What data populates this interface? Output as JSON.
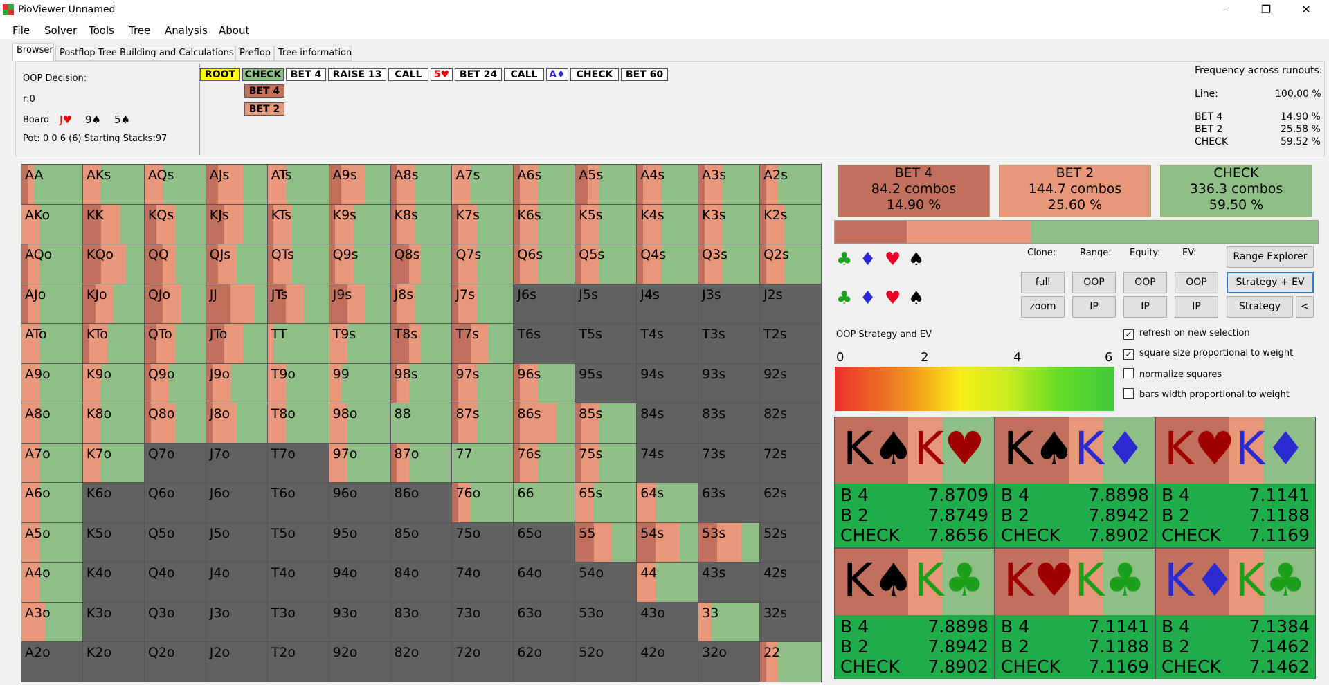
{
  "window": {
    "title": "PioViewer Unnamed",
    "controls": [
      "–",
      "❐",
      "✕"
    ]
  },
  "menu": [
    "File",
    "Solver",
    "Tools",
    "Tree",
    "Analysis",
    "About"
  ],
  "tabs": [
    "Browser",
    "Postflop Tree Building and Calculations",
    "Preflop",
    "Tree information"
  ],
  "info": {
    "decision": "OOP Decision:",
    "r": "r:0",
    "board_label": "Board",
    "board": [
      {
        "rank": "J",
        "suit": "♥",
        "color": "#e00"
      },
      {
        "rank": "9",
        "suit": "♠",
        "color": "#000"
      },
      {
        "rank": "5",
        "suit": "♠",
        "color": "#000"
      }
    ],
    "pot": "Pot: 0 0 6 (6) Starting Stacks:97"
  },
  "tree_nodes": [
    {
      "label": "ROOT",
      "bg": "#ffff00"
    },
    {
      "label": "CHECK",
      "bg": "#8fbf87"
    },
    {
      "label": "BET 4",
      "bg": "#ffffff"
    },
    {
      "label": "RAISE 13",
      "bg": "#ffffff"
    },
    {
      "label": "CALL",
      "bg": "#ffffff"
    },
    {
      "label": "5♥",
      "bg": "#ffffff",
      "color": "#e00"
    },
    {
      "label": "BET 24",
      "bg": "#ffffff"
    },
    {
      "label": "CALL",
      "bg": "#ffffff"
    },
    {
      "label": "A♦",
      "bg": "#ffffff",
      "color": "#2a2ad0"
    },
    {
      "label": "CHECK",
      "bg": "#ffffff"
    },
    {
      "label": "BET 60",
      "bg": "#ffffff"
    }
  ],
  "tree_alts": [
    {
      "label": "BET 4",
      "bg": "#c4705c"
    },
    {
      "label": "BET 2",
      "bg": "#e8977b"
    }
  ],
  "frequency": {
    "title": "Frequency across runouts:",
    "rows": [
      {
        "label": "Line:",
        "value": "100.00 %"
      },
      {
        "label": "BET 4",
        "value": "14.90 %"
      },
      {
        "label": "BET 2",
        "value": "25.58 %"
      },
      {
        "label": "CHECK",
        "value": "59.52 %"
      }
    ]
  },
  "colors": {
    "bet4": "#c0705d",
    "bet2": "#e8977b",
    "check": "#8fbf87",
    "empty": "#616161"
  },
  "grid": [
    [
      "AA",
      "AKs",
      "AQs",
      "AJs",
      "ATs",
      "A9s",
      "A8s",
      "A7s",
      "A6s",
      "A5s",
      "A4s",
      "A3s",
      "A2s"
    ],
    [
      "AKo",
      "KK",
      "KQs",
      "KJs",
      "KTs",
      "K9s",
      "K8s",
      "K7s",
      "K6s",
      "K5s",
      "K4s",
      "K3s",
      "K2s"
    ],
    [
      "AQo",
      "KQo",
      "QQ",
      "QJs",
      "QTs",
      "Q9s",
      "Q8s",
      "Q7s",
      "Q6s",
      "Q5s",
      "Q4s",
      "Q3s",
      "Q2s"
    ],
    [
      "AJo",
      "KJo",
      "QJo",
      "JJ",
      "JTs",
      "J9s",
      "J8s",
      "J7s",
      "J6s",
      "J5s",
      "J4s",
      "J3s",
      "J2s"
    ],
    [
      "ATo",
      "KTo",
      "QTo",
      "JTo",
      "TT",
      "T9s",
      "T8s",
      "T7s",
      "T6s",
      "T5s",
      "T4s",
      "T3s",
      "T2s"
    ],
    [
      "A9o",
      "K9o",
      "Q9o",
      "J9o",
      "T9o",
      "99",
      "98s",
      "97s",
      "96s",
      "95s",
      "94s",
      "93s",
      "92s"
    ],
    [
      "A8o",
      "K8o",
      "Q8o",
      "J8o",
      "T8o",
      "98o",
      "88",
      "87s",
      "86s",
      "85s",
      "84s",
      "83s",
      "82s"
    ],
    [
      "A7o",
      "K7o",
      "Q7o",
      "J7o",
      "T7o",
      "97o",
      "87o",
      "77",
      "76s",
      "75s",
      "74s",
      "73s",
      "72s"
    ],
    [
      "A6o",
      "K6o",
      "Q6o",
      "J6o",
      "T6o",
      "96o",
      "86o",
      "76o",
      "66",
      "65s",
      "64s",
      "63s",
      "62s"
    ],
    [
      "A5o",
      "K5o",
      "Q5o",
      "J5o",
      "T5o",
      "95o",
      "85o",
      "75o",
      "65o",
      "55",
      "54s",
      "53s",
      "52s"
    ],
    [
      "A4o",
      "K4o",
      "Q4o",
      "J4o",
      "T4o",
      "94o",
      "84o",
      "74o",
      "64o",
      "54o",
      "44",
      "43s",
      "42s"
    ],
    [
      "A3o",
      "K3o",
      "Q3o",
      "J3o",
      "T3o",
      "93o",
      "83o",
      "73o",
      "63o",
      "53o",
      "43o",
      "33",
      "32s"
    ],
    [
      "A2o",
      "K2o",
      "Q2o",
      "J2o",
      "T2o",
      "92o",
      "82o",
      "72o",
      "62o",
      "52o",
      "42o",
      "32o",
      "22"
    ]
  ],
  "cell_strategy": [
    [
      [
        0.1,
        0.1
      ],
      [
        0,
        0.3
      ],
      [
        0,
        0.3
      ],
      [
        0.2,
        0.4
      ],
      [
        0,
        0.3
      ],
      [
        0.2,
        0.4
      ],
      [
        0.1,
        0.3
      ],
      [
        0,
        0.3
      ],
      [
        0.1,
        0.3
      ],
      [
        0.2,
        0.2
      ],
      [
        0.1,
        0.3
      ],
      [
        0.1,
        0.3
      ],
      [
        0.1,
        0.2
      ]
    ],
    [
      [
        0,
        0.3
      ],
      [
        0.3,
        0.3
      ],
      [
        0.2,
        0.3
      ],
      [
        0.3,
        0.3
      ],
      [
        0.1,
        0.3
      ],
      [
        0.1,
        0.3
      ],
      [
        0.1,
        0.3
      ],
      [
        0.1,
        0.3
      ],
      [
        0.1,
        0.3
      ],
      [
        0.1,
        0.3
      ],
      [
        0.1,
        0.3
      ],
      [
        0.1,
        0.3
      ],
      [
        0.1,
        0.3
      ]
    ],
    [
      [
        0.1,
        0.2
      ],
      [
        0.3,
        0.4
      ],
      [
        0.3,
        0.2
      ],
      [
        0.2,
        0.3
      ],
      [
        0.1,
        0.3
      ],
      [
        0.1,
        0.3
      ],
      [
        0.3,
        0.2
      ],
      [
        0.1,
        0.3
      ],
      [
        0.1,
        0.3
      ],
      [
        0.1,
        0.3
      ],
      [
        0.1,
        0.3
      ],
      [
        0.1,
        0.3
      ],
      [
        0.1,
        0.3
      ]
    ],
    [
      [
        0.1,
        0.2
      ],
      [
        0.2,
        0.3
      ],
      [
        0.3,
        0.3
      ],
      [
        0.4,
        0.4
      ],
      [
        0.3,
        0.3
      ],
      [
        0.3,
        0.3
      ],
      [
        0.1,
        0.3
      ],
      [
        0.1,
        0.3
      ],
      [
        0,
        0
      ],
      [
        0,
        0
      ],
      [
        0,
        0
      ],
      [
        0,
        0
      ],
      [
        0,
        0
      ]
    ],
    [
      [
        0,
        0.3
      ],
      [
        0.1,
        0.3
      ],
      [
        0.2,
        0.3
      ],
      [
        0.3,
        0.3
      ],
      [
        0,
        0.1
      ],
      [
        0,
        0.3
      ],
      [
        0.3,
        0.2
      ],
      [
        0.3,
        0.3
      ],
      [
        0,
        0
      ],
      [
        0,
        0
      ],
      [
        0,
        0
      ],
      [
        0,
        0
      ],
      [
        0,
        0
      ]
    ],
    [
      [
        0,
        0.3
      ],
      [
        0,
        0.3
      ],
      [
        0.1,
        0.3
      ],
      [
        0.1,
        0.3
      ],
      [
        0,
        0.3
      ],
      [
        0,
        0.2
      ],
      [
        0.1,
        0.2
      ],
      [
        0.1,
        0.3
      ],
      [
        0.1,
        0.3
      ],
      [
        0,
        0
      ],
      [
        0,
        0
      ],
      [
        0,
        0
      ],
      [
        0,
        0
      ]
    ],
    [
      [
        0,
        0.3
      ],
      [
        0,
        0.3
      ],
      [
        0.1,
        0.4
      ],
      [
        0.1,
        0.4
      ],
      [
        0,
        0.3
      ],
      [
        0,
        0.3
      ],
      [
        0,
        0
      ],
      [
        0.1,
        0.3
      ],
      [
        0.1,
        0.6
      ],
      [
        0.1,
        0.3
      ],
      [
        0,
        0
      ],
      [
        0,
        0
      ],
      [
        0,
        0
      ]
    ],
    [
      [
        0,
        0.3
      ],
      [
        0,
        0.3
      ],
      [
        0,
        0
      ],
      [
        0,
        0
      ],
      [
        0,
        0
      ],
      [
        0,
        0.3
      ],
      [
        0.1,
        0.2
      ],
      [
        0,
        0
      ],
      [
        0.1,
        0.3
      ],
      [
        0.1,
        0.3
      ],
      [
        0,
        0
      ],
      [
        0,
        0
      ],
      [
        0,
        0
      ]
    ],
    [
      [
        0,
        0.3
      ],
      [
        0,
        0
      ],
      [
        0,
        0
      ],
      [
        0,
        0
      ],
      [
        0,
        0
      ],
      [
        0,
        0
      ],
      [
        0,
        0
      ],
      [
        0.1,
        0.2
      ],
      [
        0,
        0
      ],
      [
        0,
        0.3
      ],
      [
        0,
        0.3
      ],
      [
        0,
        0
      ],
      [
        0,
        0
      ]
    ],
    [
      [
        0,
        0.3
      ],
      [
        0,
        0
      ],
      [
        0,
        0
      ],
      [
        0,
        0
      ],
      [
        0,
        0
      ],
      [
        0,
        0
      ],
      [
        0,
        0
      ],
      [
        0,
        0
      ],
      [
        0,
        0
      ],
      [
        0.3,
        0.3
      ],
      [
        0.3,
        0.4
      ],
      [
        0.3,
        0.4
      ],
      [
        0,
        0
      ]
    ],
    [
      [
        0,
        0.3
      ],
      [
        0,
        0
      ],
      [
        0,
        0
      ],
      [
        0,
        0
      ],
      [
        0,
        0
      ],
      [
        0,
        0
      ],
      [
        0,
        0
      ],
      [
        0,
        0
      ],
      [
        0,
        0
      ],
      [
        0,
        0
      ],
      [
        0,
        0.3
      ],
      [
        0,
        0
      ],
      [
        0,
        0
      ]
    ],
    [
      [
        0,
        0.4
      ],
      [
        0,
        0
      ],
      [
        0,
        0
      ],
      [
        0,
        0
      ],
      [
        0,
        0
      ],
      [
        0,
        0
      ],
      [
        0,
        0
      ],
      [
        0,
        0
      ],
      [
        0,
        0
      ],
      [
        0,
        0
      ],
      [
        0,
        0
      ],
      [
        0,
        0.2
      ],
      [
        0,
        0
      ]
    ],
    [
      [
        0,
        0
      ],
      [
        0,
        0
      ],
      [
        0,
        0
      ],
      [
        0,
        0
      ],
      [
        0,
        0
      ],
      [
        0,
        0
      ],
      [
        0,
        0
      ],
      [
        0,
        0
      ],
      [
        0,
        0
      ],
      [
        0,
        0
      ],
      [
        0,
        0
      ],
      [
        0,
        0
      ],
      [
        0.1,
        0.2
      ]
    ]
  ],
  "actions": [
    {
      "name": "BET 4",
      "combos": "84.2 combos",
      "pct": "14.90 %",
      "bg": "#c0705d"
    },
    {
      "name": "BET 2",
      "combos": "144.7 combos",
      "pct": "25.60 %",
      "bg": "#e8977b"
    },
    {
      "name": "CHECK",
      "combos": "336.3 combos",
      "pct": "59.50 %",
      "bg": "#8fbf87"
    }
  ],
  "strategy_bar": [
    0.149,
    0.256,
    0.595
  ],
  "suits": [
    {
      "s": "♣",
      "color": "#1aa01a"
    },
    {
      "s": "♦",
      "color": "#2a2ad0"
    },
    {
      "s": "♥",
      "color": "#e8002a"
    },
    {
      "s": "♠",
      "color": "#000000"
    }
  ],
  "controls": {
    "clone": "Clone:",
    "range": "Range:",
    "equity": "Equity:",
    "ev": "EV:",
    "full": "full",
    "zoom": "zoom",
    "oop": "OOP",
    "ip": "IP",
    "range_explorer": "Range Explorer",
    "strategy_ev": "Strategy + EV",
    "strategy": "Strategy",
    "back": "<"
  },
  "checkboxes": [
    {
      "label": "refresh on new selection",
      "checked": true,
      "mark": "✓"
    },
    {
      "label": "square size proportional to weight",
      "checked": true,
      "mark": "✓"
    },
    {
      "label": "normalize squares",
      "checked": false,
      "mark": ""
    },
    {
      "label": "bars width proportional to weight",
      "checked": false,
      "mark": ""
    }
  ],
  "ev_legend": {
    "title": "OOP Strategy and EV",
    "ticks": [
      "0",
      "2",
      "4",
      "6"
    ]
  },
  "combos": [
    {
      "c1": "K",
      "s1": "♠",
      "col1": "#000",
      "c2": "K",
      "s2": "♥",
      "col2": "#a00000",
      "b4": "7.8709",
      "b2": "7.8749",
      "ck": "7.8656"
    },
    {
      "c1": "K",
      "s1": "♠",
      "col1": "#000",
      "c2": "K",
      "s2": "♦",
      "col2": "#2a2ad0",
      "b4": "7.8898",
      "b2": "7.8942",
      "ck": "7.8902"
    },
    {
      "c1": "K",
      "s1": "♥",
      "col1": "#a00000",
      "c2": "K",
      "s2": "♦",
      "col2": "#2a2ad0",
      "b4": "7.1141",
      "b2": "7.1188",
      "ck": "7.1169"
    },
    {
      "c1": "K",
      "s1": "♠",
      "col1": "#000",
      "c2": "K",
      "s2": "♣",
      "col2": "#1aa01a",
      "b4": "7.8898",
      "b2": "7.8942",
      "ck": "7.8902"
    },
    {
      "c1": "K",
      "s1": "♥",
      "col1": "#a00000",
      "c2": "K",
      "s2": "♣",
      "col2": "#1aa01a",
      "b4": "7.1141",
      "b2": "7.1188",
      "ck": "7.1169"
    },
    {
      "c1": "K",
      "s1": "♦",
      "col1": "#2a2ad0",
      "c2": "K",
      "s2": "♣",
      "col2": "#1aa01a",
      "b4": "7.1384",
      "b2": "7.1462",
      "ck": "7.1462"
    }
  ],
  "combo_labels": {
    "b4": "B 4",
    "b2": "B 2",
    "ck": "CHECK"
  }
}
